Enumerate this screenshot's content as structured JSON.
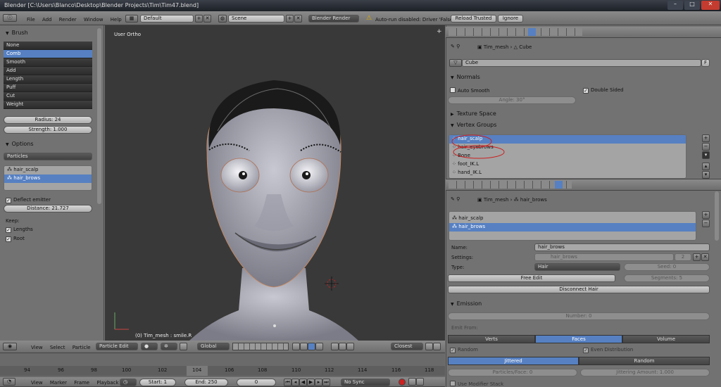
{
  "window": {
    "title": "Blender [C:\\Users\\Blanco\\Desktop\\Blender Projects\\Tim\\Tim47.blend]",
    "minimize": "–",
    "maximize": "□",
    "close": "✕"
  },
  "topbar": {
    "menus": [
      "File",
      "Add",
      "Render",
      "Window",
      "Help"
    ],
    "layout": "Default",
    "scene": "Scene",
    "engine": "Blender Render",
    "warning": "Auto-run disabled: Driver 'False'",
    "reload": "Reload Trusted",
    "ignore": "Ignore"
  },
  "tool_panel": {
    "brush_header": "Brush",
    "brushes": [
      "None",
      "Comb",
      "Smooth",
      "Add",
      "Length",
      "Puff",
      "Cut",
      "Weight"
    ],
    "selected_brush": 1,
    "radius": "Radius: 24",
    "strength": "Strength: 1.000",
    "options_header": "Options",
    "particles_select": "Particles",
    "systems": [
      "hair_scalp",
      "hair_brows"
    ],
    "selected_system": 1,
    "deflect_emitter": "Deflect emitter",
    "distance": "Distance: 21.727",
    "keep_label": "Keep:",
    "lengths": "Lengths",
    "root": "Root"
  },
  "viewport": {
    "label": "User Ortho",
    "object_info": "(0) Tim_mesh : smile.R"
  },
  "viewport_header": {
    "menus": [
      "View",
      "Select",
      "Particle"
    ],
    "mode": "Particle Edit",
    "orientation": "Global",
    "snap": "Closest"
  },
  "timeline": {
    "ticks": [
      "94",
      "96",
      "98",
      "100",
      "102",
      "104",
      "106",
      "108",
      "110",
      "112",
      "114",
      "116",
      "118"
    ],
    "menus": [
      "View",
      "Marker",
      "Frame",
      "Playback"
    ],
    "start": "Start: 1",
    "end": "End: 250",
    "current": "0",
    "sync": "No Sync"
  },
  "mesh_props": {
    "breadcrumb_obj": "Tim_mesh",
    "breadcrumb_data": "Cube",
    "datablock": "Cube",
    "fake": "F",
    "normals_header": "Normals",
    "auto_smooth": "Auto Smooth",
    "double_sided": "Double Sided",
    "angle": "Angle: 30°",
    "texture_space": "Texture Space",
    "vertex_groups_header": "Vertex Groups",
    "vertex_groups": [
      "hair_scalp",
      "hair_eyebrows",
      "Bone",
      "foot_IK.L",
      "hand_IK.L"
    ]
  },
  "particle_props": {
    "breadcrumb_obj": "Tim_mesh",
    "breadcrumb_data": "hair_brows",
    "systems": [
      "hair_scalp",
      "hair_brows"
    ],
    "selected_system": 1,
    "name_label": "Name:",
    "name": "hair_brows",
    "settings_label": "Settings:",
    "settings": "hair_brows",
    "users": "2",
    "type_label": "Type:",
    "type": "Hair",
    "seed": "Seed: 0",
    "free_edit": "Free Edit",
    "segments": "Segments: 5",
    "disconnect": "Disconnect Hair",
    "emission_header": "Emission",
    "number": "Number: 0",
    "emit_from": "Emit From:",
    "emit_options": [
      "Verts",
      "Faces",
      "Volume"
    ],
    "emit_selected": 1,
    "random": "Random",
    "even_distribution": "Even Distribution",
    "dist_options": [
      "Jittered",
      "Random"
    ],
    "dist_selected": 0,
    "particles_face": "Particles/Face: 0",
    "jitter": "Jittering Amount: 1.000",
    "modifier_stack": "Use Modifier Stack"
  },
  "colors": {
    "accent": "#5680c2",
    "viewport_bg": "#393939",
    "panel_bg": "#727272",
    "annotation": "#cc2020"
  }
}
